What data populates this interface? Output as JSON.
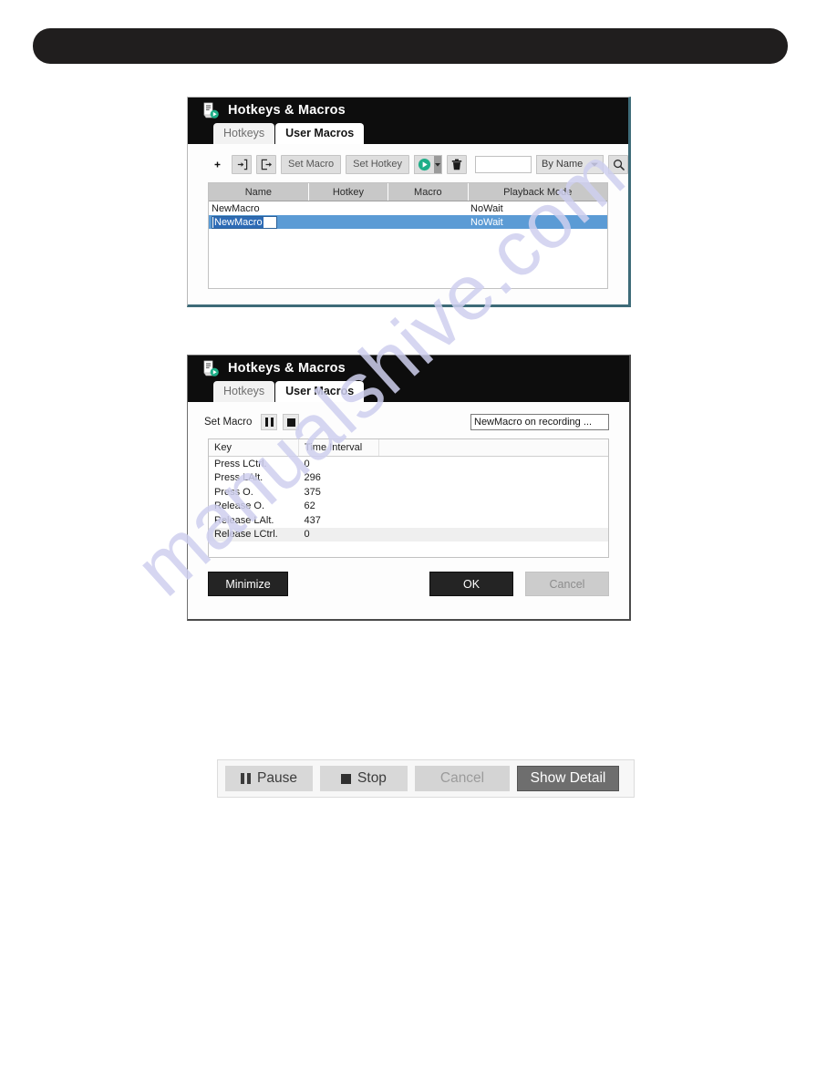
{
  "watermark": {
    "text": "manualshive.com"
  },
  "top_bar": {
    "redacted": true
  },
  "panel_macros": {
    "header": {
      "icon": "macro-document-icon",
      "title": "Hotkeys & Macros",
      "tabs": [
        {
          "label": "Hotkeys",
          "active": false
        },
        {
          "label": "User Macros",
          "active": true
        }
      ]
    },
    "toolbar": {
      "add_label": "+",
      "import_label": "import-icon",
      "export_label": "export-icon",
      "set_macro_label": "Set Macro",
      "set_hotkey_label": "Set Hotkey",
      "play_label": "play-icon",
      "play_caret_label": "▾",
      "delete_label": "trash-icon",
      "search_value": "",
      "search_placeholder": "",
      "sort_value": "By Name",
      "sort_caret": "▼",
      "search_icon": "search-icon"
    },
    "table": {
      "columns": [
        "Name",
        "Hotkey",
        "Macro",
        "Playback Mode"
      ],
      "rows": [
        {
          "name": "NewMacro",
          "hotkey": "",
          "macro": "",
          "playback_mode": "NoWait",
          "selected": false,
          "editing": false
        },
        {
          "name": "NewMacro",
          "hotkey": "",
          "macro": "",
          "playback_mode": "NoWait",
          "selected": true,
          "editing": true
        }
      ]
    }
  },
  "panel_recording": {
    "header": {
      "icon": "macro-document-icon",
      "title": "Hotkeys & Macros",
      "tabs": [
        {
          "label": "Hotkeys",
          "active": false
        },
        {
          "label": "User Macros",
          "active": true
        }
      ]
    },
    "set_macro": {
      "label": "Set Macro",
      "pause_label": "pause-icon",
      "stop_label": "stop-icon",
      "status_value": "NewMacro on recording ..."
    },
    "keylog": {
      "columns": [
        "Key",
        "Time Interval",
        ""
      ],
      "rows": [
        {
          "key": "Press LCtrl.",
          "interval": "0"
        },
        {
          "key": "Press LAlt.",
          "interval": "296"
        },
        {
          "key": "Press O.",
          "interval": "375"
        },
        {
          "key": "Release O.",
          "interval": "62"
        },
        {
          "key": "Release LAlt.",
          "interval": "437"
        },
        {
          "key": "Release LCtrl.",
          "interval": "0"
        }
      ]
    },
    "buttons": {
      "minimize_label": "Minimize",
      "ok_label": "OK",
      "cancel_label": "Cancel"
    }
  },
  "bottom_toolbar": {
    "pause_label": "Pause",
    "stop_label": "Stop",
    "cancel_label": "Cancel",
    "show_detail_label": "Show Detail"
  },
  "colors": {
    "header_black": "#0d0d0d",
    "accent_green": "#1fae88",
    "selection_blue": "#5b9bd5",
    "panel_border_teal": "#3d6b78",
    "watermark": "#cfd0ef"
  }
}
